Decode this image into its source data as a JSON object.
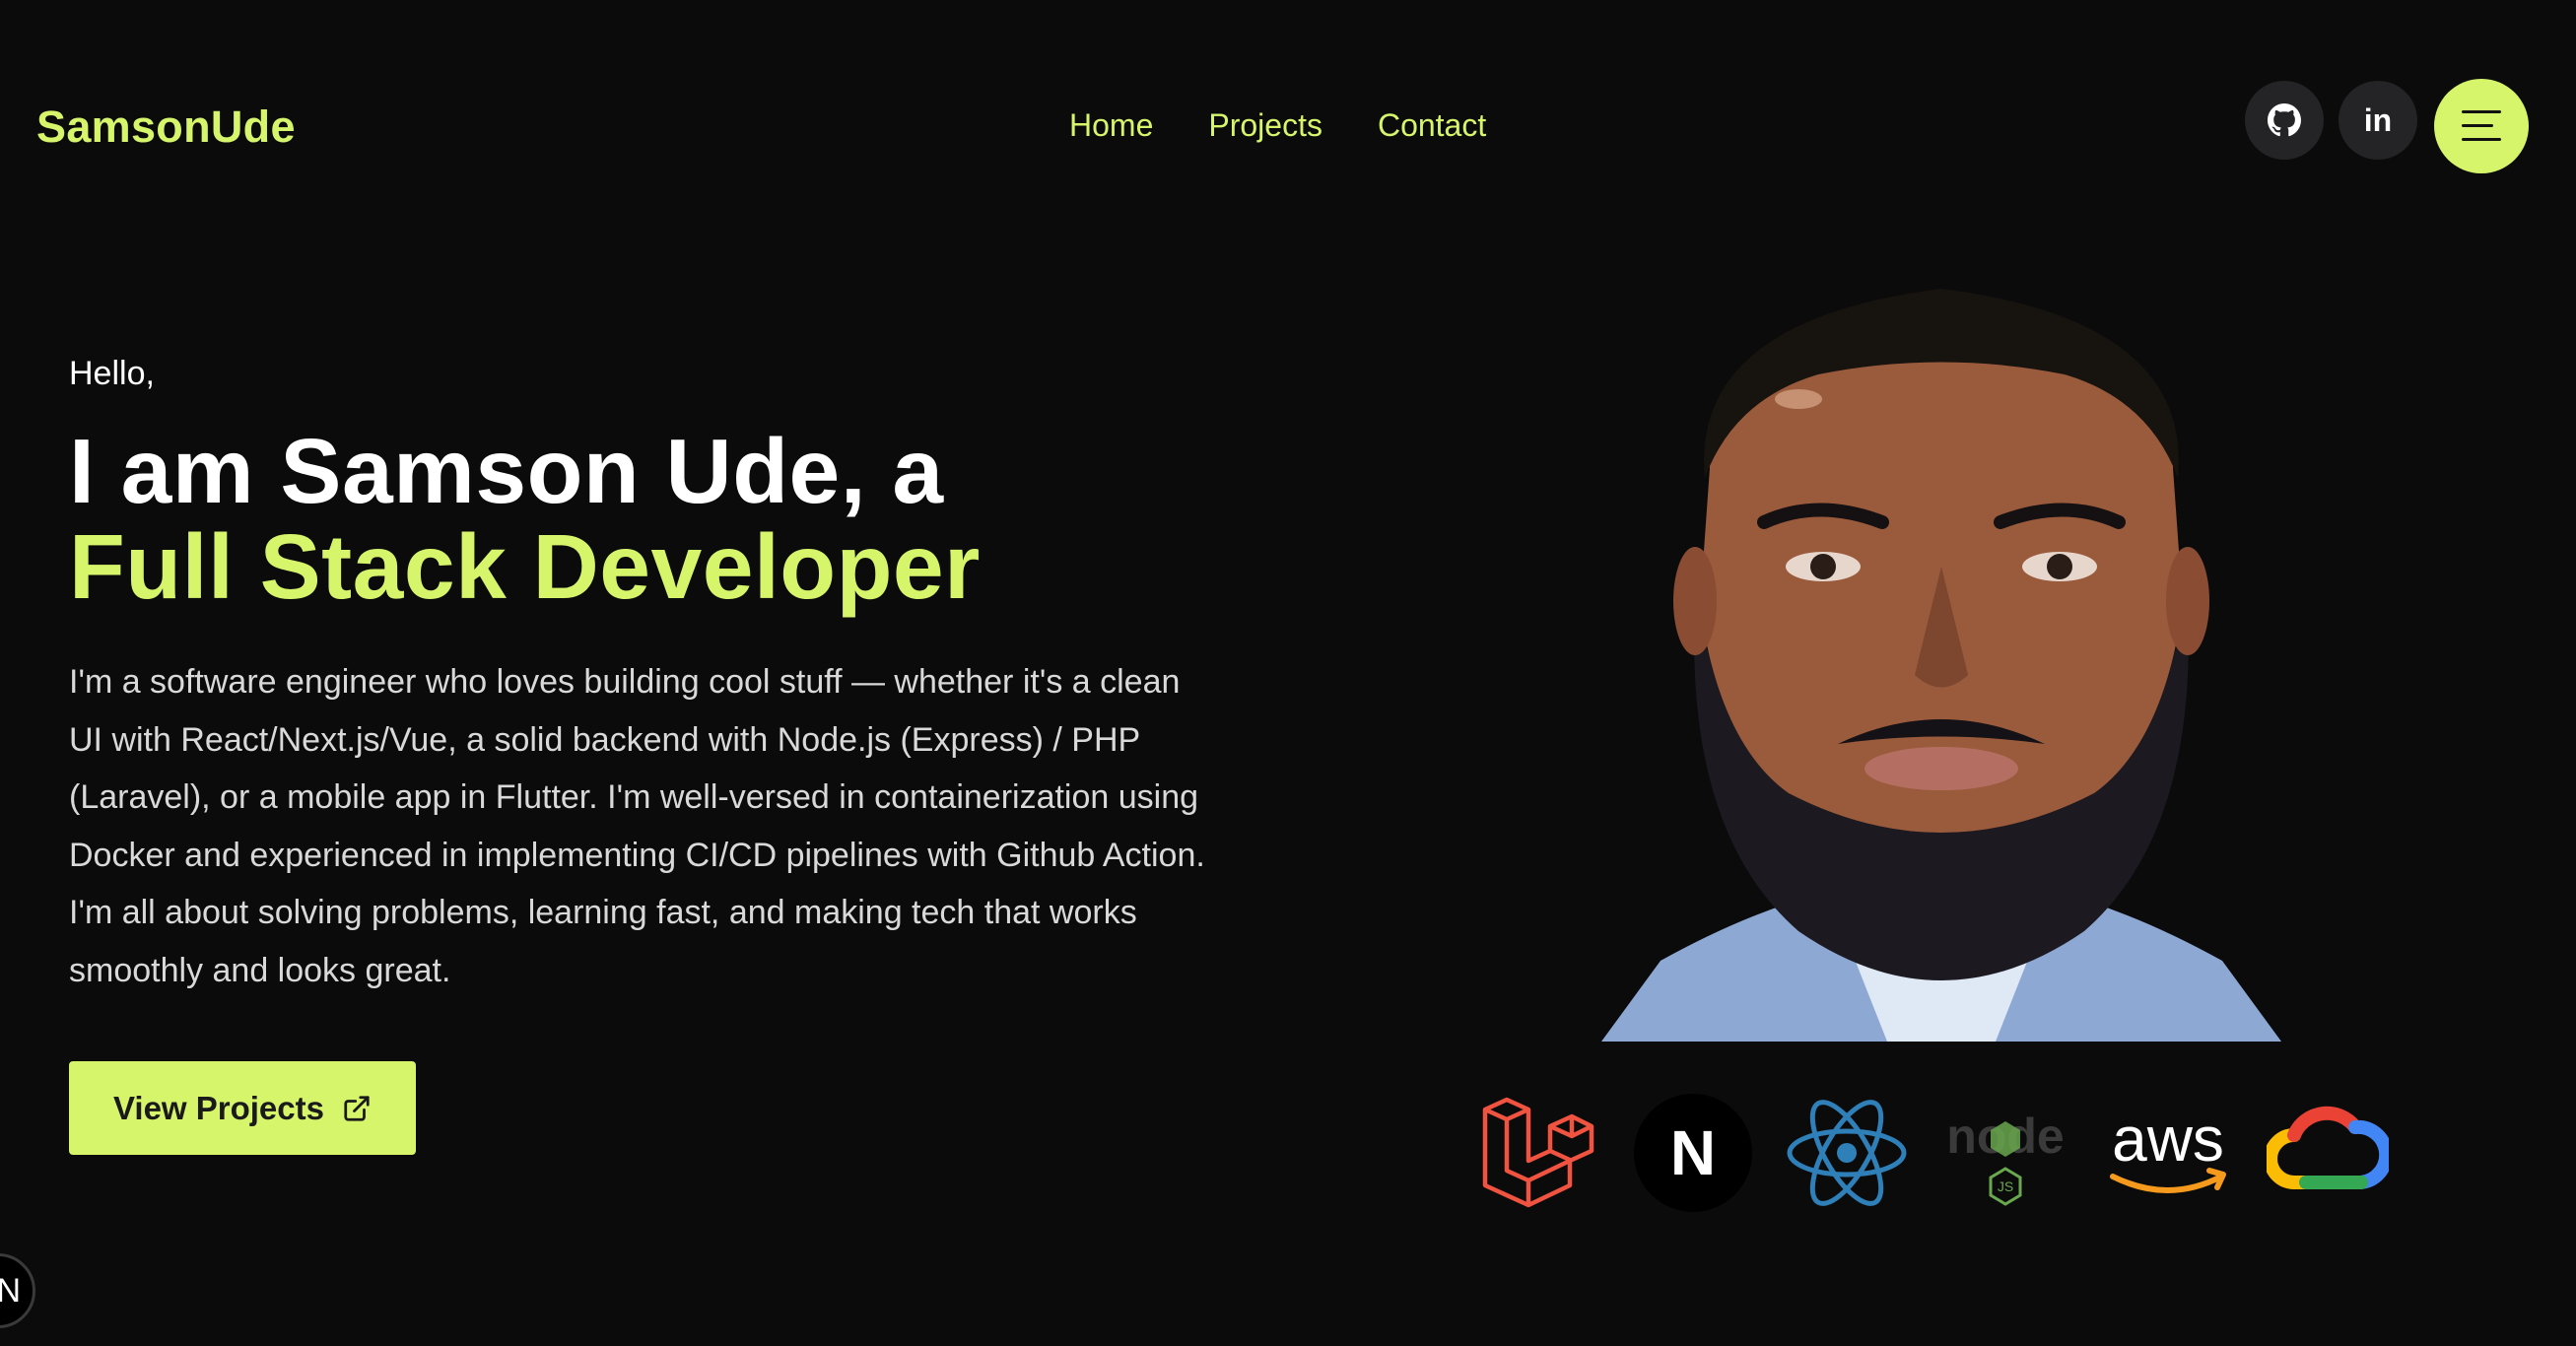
{
  "brand": {
    "logo_text": "SamsonUde",
    "accent_color": "#d6f56b"
  },
  "nav": {
    "items": [
      "Home",
      "Projects",
      "Contact"
    ]
  },
  "header_actions": {
    "github_icon": "github-icon",
    "linkedin_icon": "linkedin-icon",
    "linkedin_text": "in",
    "menu_icon": "hamburger-menu-icon"
  },
  "hero": {
    "greeting": "Hello,",
    "headline_line1": "I am Samson Ude, a",
    "headline_line2": "Full Stack Developer",
    "bio": "I'm a software engineer who loves building cool stuff — whether it's a clean UI with React/Next.js/Vue, a solid backend with Node.js (Express) / PHP (Laravel), or a mobile app in Flutter. I'm well-versed in containerization using Docker and experienced in implementing CI/CD pipelines with Github Action. I'm all about solving problems, learning fast, and making tech that works smoothly and looks great.",
    "cta_label": "View Projects",
    "cta_icon": "external-link-icon"
  },
  "portrait": {
    "alt": "portrait-photo"
  },
  "tech_stack": [
    {
      "name": "laravel-logo",
      "label": ""
    },
    {
      "name": "nextjs-logo",
      "label": "N"
    },
    {
      "name": "react-logo",
      "label": ""
    },
    {
      "name": "nodejs-logo",
      "label": "node"
    },
    {
      "name": "aws-logo",
      "label": "aws"
    },
    {
      "name": "google-cloud-logo",
      "label": ""
    }
  ],
  "corner_badge": {
    "label": "N",
    "icon": "nextjs-dev-indicator-icon"
  }
}
